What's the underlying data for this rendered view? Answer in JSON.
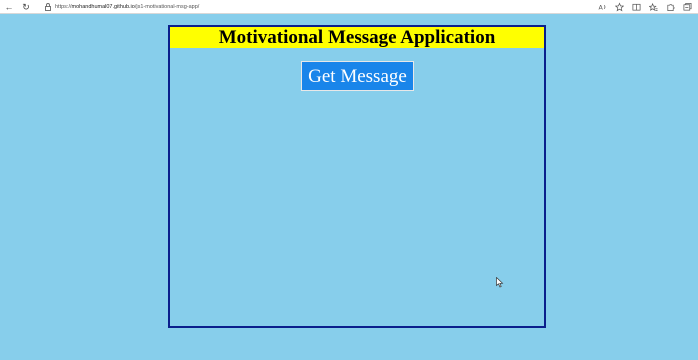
{
  "browser": {
    "url_prefix": "https://",
    "url_host": "mohandhumal07.github.io",
    "url_path": "/js1-motivational-msg-app/"
  },
  "app": {
    "title": "Motivational Message Application",
    "button_label": "Get Message",
    "message": ""
  },
  "colors": {
    "page_background": "#87ceeb",
    "title_background": "#ffff00",
    "button_background": "#1985ea",
    "box_border": "#0b1f8c"
  },
  "icons": [
    "back-arrow-icon",
    "refresh-icon",
    "lock-icon",
    "read-aloud-icon",
    "favorite-star-icon",
    "split-screen-icon",
    "favorites-icon",
    "extensions-icon",
    "collections-icon"
  ]
}
